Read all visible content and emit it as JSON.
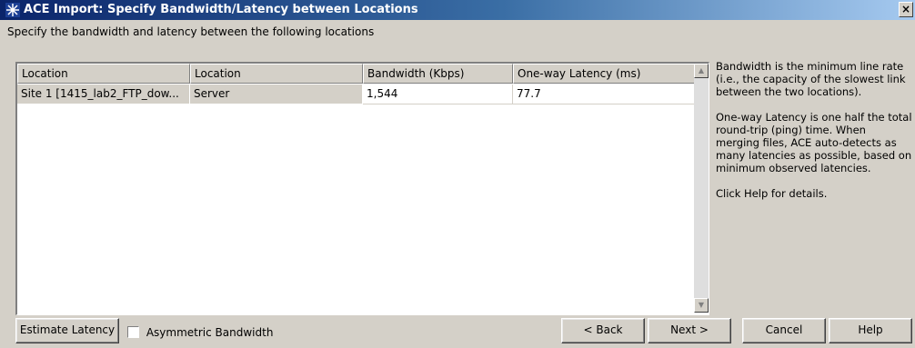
{
  "window": {
    "title": "ACE Import: Specify Bandwidth/Latency between Locations",
    "close_glyph": "×"
  },
  "instruction": "Specify the bandwidth and latency between the following locations",
  "grid": {
    "headers": [
      "Location",
      "Location",
      "Bandwidth (Kbps)",
      "One-way Latency (ms)"
    ],
    "rows": [
      [
        "Site 1 [1415_lab2_FTP_dow...",
        "Server",
        "1,544",
        "77.7"
      ]
    ]
  },
  "help": {
    "para1": "Bandwidth is the minimum line rate (i.e., the capacity of the slowest link between the two locations).",
    "para2": "One-way Latency is one half the total round-trip (ping) time.  When merging files, ACE auto-detects as many latencies as possible, based on minimum observed latencies.",
    "para3": "Click Help for details."
  },
  "buttons": {
    "estimate": "Estimate Latency",
    "asymmetric_label": "Asymmetric Bandwidth",
    "asymmetric_checked": false,
    "back": "< Back",
    "next": "Next >",
    "cancel": "Cancel",
    "help": "Help"
  },
  "icons": {
    "title_icon": "ace-star-icon",
    "scroll_up": "scroll-up-arrow-icon",
    "scroll_down": "scroll-down-arrow-icon"
  },
  "colors": {
    "title_start": "#0a246a",
    "title_end": "#a6caf0",
    "face": "#d4d0c8"
  }
}
